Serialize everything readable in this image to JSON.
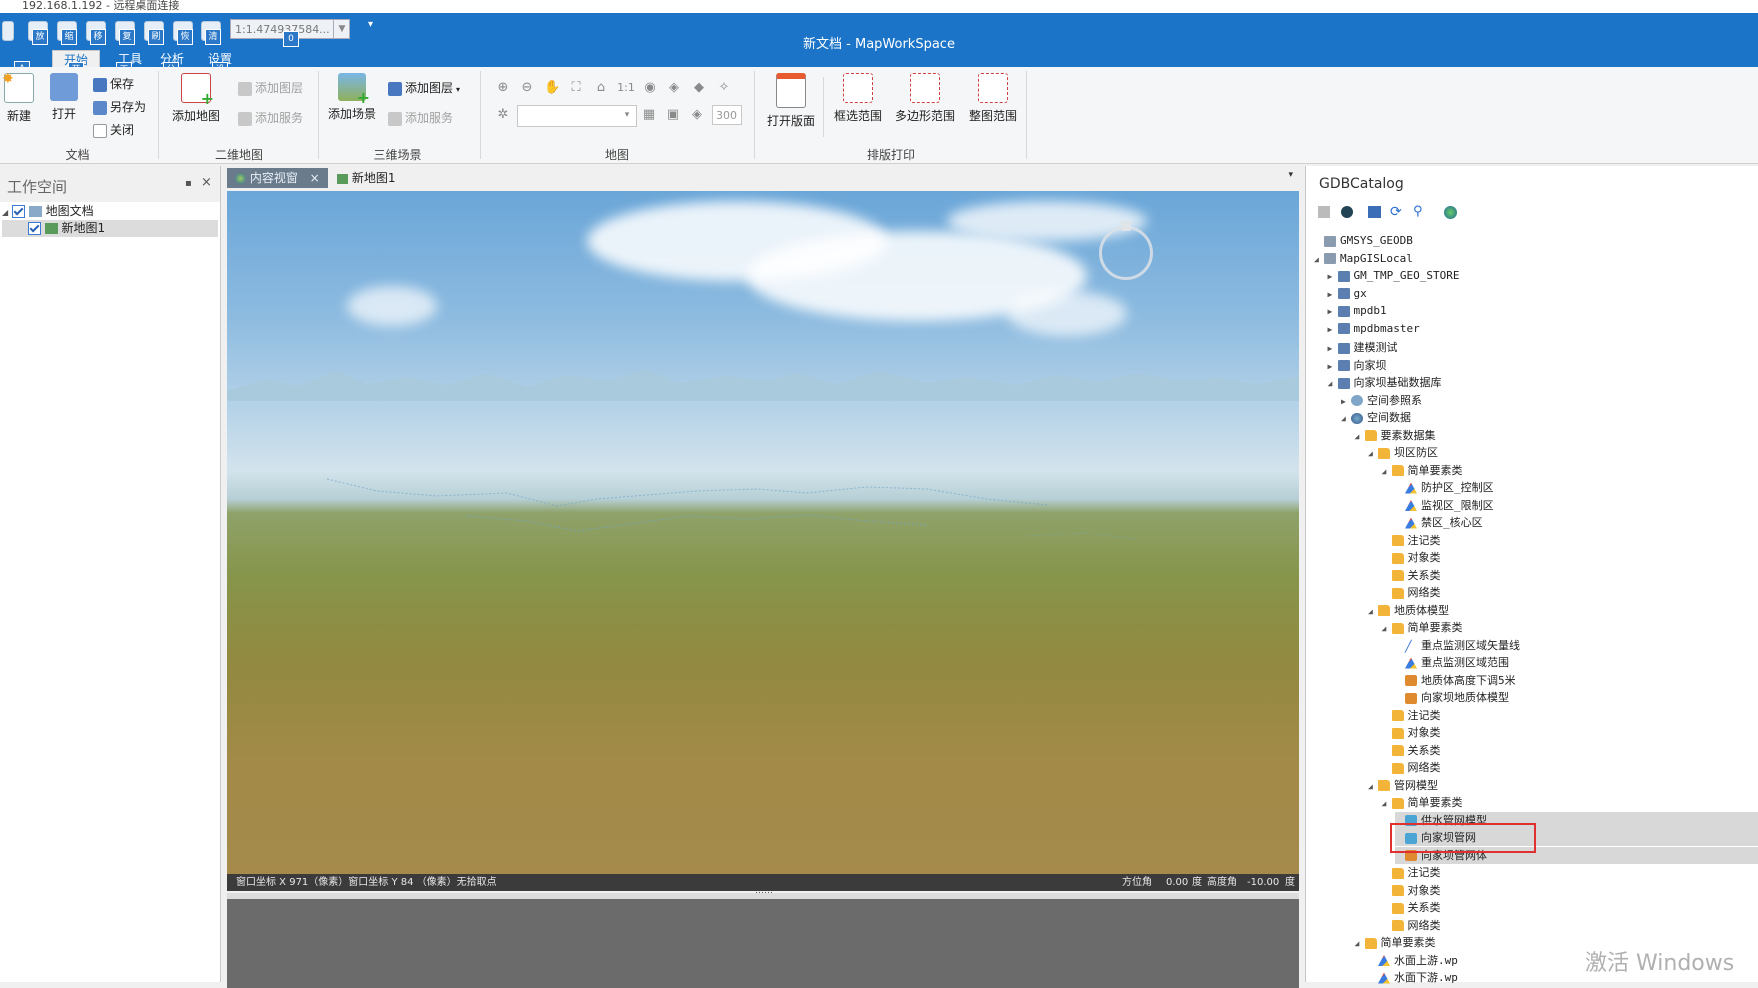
{
  "window": {
    "caption": "192.168.1.192 - 远程桌面连接",
    "title": "新文档 - MapWorkSpace"
  },
  "quick_access": {
    "keys": [
      "放",
      "缩",
      "移",
      "复",
      "刷",
      "恢",
      "清"
    ],
    "scale_value": "1:1.474937584...",
    "scale_key": "0"
  },
  "menu_tabs": [
    {
      "label": "开始",
      "key": "开"
    },
    {
      "label": "工具",
      "key": "工"
    },
    {
      "label": "分析",
      "key": "分"
    },
    {
      "label": "设置",
      "key": "设"
    }
  ],
  "menu_prefix_key": "A",
  "ribbon": {
    "document": {
      "label": "文档",
      "new": "新建",
      "open": "打开",
      "save": "保存",
      "save_as": "另存为",
      "close": "关闭"
    },
    "map2d": {
      "label": "二维地图",
      "add_map": "添加地图",
      "add_layer": "添加图层",
      "add_service": "添加服务"
    },
    "scene3d": {
      "label": "三维场景",
      "add_scene": "添加场景",
      "add_layer": "添加图层",
      "add_service": "添加服务"
    },
    "map": {
      "label": "地图",
      "ratio": "1:1",
      "size_value": "300"
    },
    "print": {
      "label": "排版打印",
      "open_layout": "打开版面",
      "rect_extent": "框选范围",
      "polygon_extent": "多边形范围",
      "full_extent": "整图范围"
    }
  },
  "workspace": {
    "title": "工作空间",
    "tree": [
      {
        "label": "地图文档",
        "level": 0
      },
      {
        "label": "新地图1",
        "level": 1
      }
    ]
  },
  "doc_tabs": [
    {
      "label": "内容视窗",
      "active": true
    },
    {
      "label": "新地图1",
      "active": false
    }
  ],
  "scene_status": {
    "left": "窗口坐标 X 971（像素）窗口坐标 Y 84 （像素）无拾取点",
    "azimuth_label": "方位角",
    "azimuth_value": "0.00",
    "azimuth_unit": "度",
    "elevation_label": "高度角",
    "elevation_value": "-10.00",
    "elevation_unit": "度"
  },
  "splitter_dots": "……",
  "catalog": {
    "title": "GDBCatalog",
    "tree": [
      {
        "label": "GMSYS_GEODB",
        "level": 0,
        "icon": "pc",
        "exp": ""
      },
      {
        "label": "MapGISLocal",
        "level": 0,
        "icon": "pc",
        "exp": "◢"
      },
      {
        "label": "GM_TMP_GEO_STORE",
        "level": 1,
        "icon": "db",
        "exp": "▶"
      },
      {
        "label": "gx",
        "level": 1,
        "icon": "db",
        "exp": "▶"
      },
      {
        "label": "mpdb1",
        "level": 1,
        "icon": "db",
        "exp": "▶"
      },
      {
        "label": "mpdbmaster",
        "level": 1,
        "icon": "db",
        "exp": "▶"
      },
      {
        "label": "建模测试",
        "level": 1,
        "icon": "db",
        "exp": "▶"
      },
      {
        "label": "向家坝",
        "level": 1,
        "icon": "db",
        "exp": "▶"
      },
      {
        "label": "向家坝基础数据库",
        "level": 1,
        "icon": "db",
        "exp": "◢"
      },
      {
        "label": "空间参照系",
        "level": 2,
        "icon": "sref",
        "exp": "▶"
      },
      {
        "label": "空间数据",
        "level": 2,
        "icon": "globe",
        "exp": "◢"
      },
      {
        "label": "要素数据集",
        "level": 3,
        "icon": "folder",
        "exp": "◢"
      },
      {
        "label": "坝区防区",
        "level": 4,
        "icon": "folder",
        "exp": "◢"
      },
      {
        "label": "简单要素类",
        "level": 5,
        "icon": "folder",
        "exp": "◢"
      },
      {
        "label": "防护区_控制区",
        "level": 6,
        "icon": "poly",
        "exp": ""
      },
      {
        "label": "监视区_限制区",
        "level": 6,
        "icon": "poly",
        "exp": ""
      },
      {
        "label": "禁区_核心区",
        "level": 6,
        "icon": "poly",
        "exp": ""
      },
      {
        "label": "注记类",
        "level": 5,
        "icon": "folder",
        "exp": ""
      },
      {
        "label": "对象类",
        "level": 5,
        "icon": "folder",
        "exp": ""
      },
      {
        "label": "关系类",
        "level": 5,
        "icon": "folder",
        "exp": ""
      },
      {
        "label": "网络类",
        "level": 5,
        "icon": "folder",
        "exp": ""
      },
      {
        "label": "地质体模型",
        "level": 4,
        "icon": "folder",
        "exp": "◢"
      },
      {
        "label": "简单要素类",
        "level": 5,
        "icon": "folder",
        "exp": "◢"
      },
      {
        "label": "重点监测区域矢量线",
        "level": 6,
        "icon": "line",
        "exp": ""
      },
      {
        "label": "重点监测区域范围",
        "level": 6,
        "icon": "poly",
        "exp": ""
      },
      {
        "label": "地质体高度下调5米",
        "level": 6,
        "icon": "model",
        "exp": ""
      },
      {
        "label": "向家坝地质体模型",
        "level": 6,
        "icon": "model",
        "exp": ""
      },
      {
        "label": "注记类",
        "level": 5,
        "icon": "folder",
        "exp": ""
      },
      {
        "label": "对象类",
        "level": 5,
        "icon": "folder",
        "exp": ""
      },
      {
        "label": "关系类",
        "level": 5,
        "icon": "folder",
        "exp": ""
      },
      {
        "label": "网络类",
        "level": 5,
        "icon": "folder",
        "exp": ""
      },
      {
        "label": "管网模型",
        "level": 4,
        "icon": "folder",
        "exp": "◢"
      },
      {
        "label": "简单要素类",
        "level": 5,
        "icon": "folder",
        "exp": "◢"
      },
      {
        "label": "供水管网模型",
        "level": 6,
        "icon": "net",
        "exp": ""
      },
      {
        "label": "向家坝管网",
        "level": 6,
        "icon": "net",
        "exp": ""
      },
      {
        "label": "向家坝管网体",
        "level": 6,
        "icon": "model",
        "exp": ""
      },
      {
        "label": "注记类",
        "level": 5,
        "icon": "folder",
        "exp": ""
      },
      {
        "label": "对象类",
        "level": 5,
        "icon": "folder",
        "exp": ""
      },
      {
        "label": "关系类",
        "level": 5,
        "icon": "folder",
        "exp": ""
      },
      {
        "label": "网络类",
        "level": 5,
        "icon": "folder",
        "exp": ""
      },
      {
        "label": "简单要素类",
        "level": 3,
        "icon": "folder",
        "exp": "◢"
      },
      {
        "label": "水面上游.wp",
        "level": 4,
        "icon": "poly",
        "exp": ""
      },
      {
        "label": "水面下游.wp",
        "level": 4,
        "icon": "poly",
        "exp": ""
      }
    ]
  },
  "watermark": "激活 Windows",
  "colors": {
    "accent": "#1c74c8",
    "highlight_box": "#e03030"
  }
}
